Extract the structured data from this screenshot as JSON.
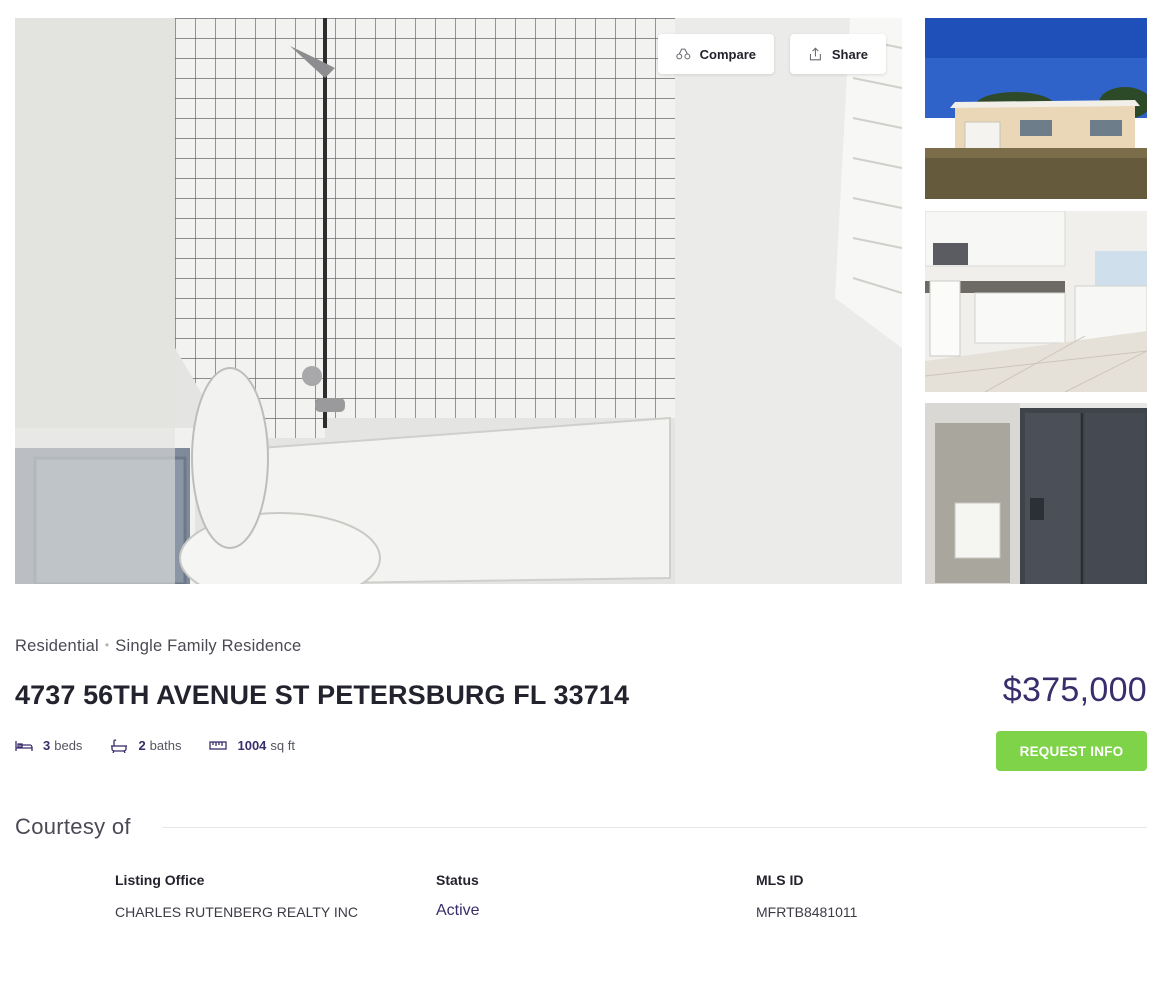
{
  "gallery": {
    "main_alt": "Bathroom with tiled tub and toilet",
    "thumbnails": [
      "house-exterior",
      "kitchen",
      "refrigerator-and-laundry"
    ]
  },
  "actions": {
    "compare_label": "Compare",
    "share_label": "Share"
  },
  "property": {
    "type": "Residential",
    "subtype": "Single Family Residence",
    "address": "4737 56TH AVENUE ST PETERSBURG FL 33714",
    "price": "$375,000",
    "beds_num": "3",
    "beds_unit": "beds",
    "baths_num": "2",
    "baths_unit": "baths",
    "sqft_num": "1004",
    "sqft_unit": "sq ft"
  },
  "cta": {
    "request_label": "REQUEST INFO"
  },
  "courtesy": {
    "heading": "Courtesy of",
    "listing_office_label": "Listing Office",
    "listing_office_value": "CHARLES RUTENBERG REALTY INC",
    "status_label": "Status",
    "status_value": "Active",
    "mls_label": "MLS ID",
    "mls_value": "MFRTB8481011"
  },
  "colors": {
    "accent": "#3a2d6b",
    "cta": "#7ed348"
  }
}
